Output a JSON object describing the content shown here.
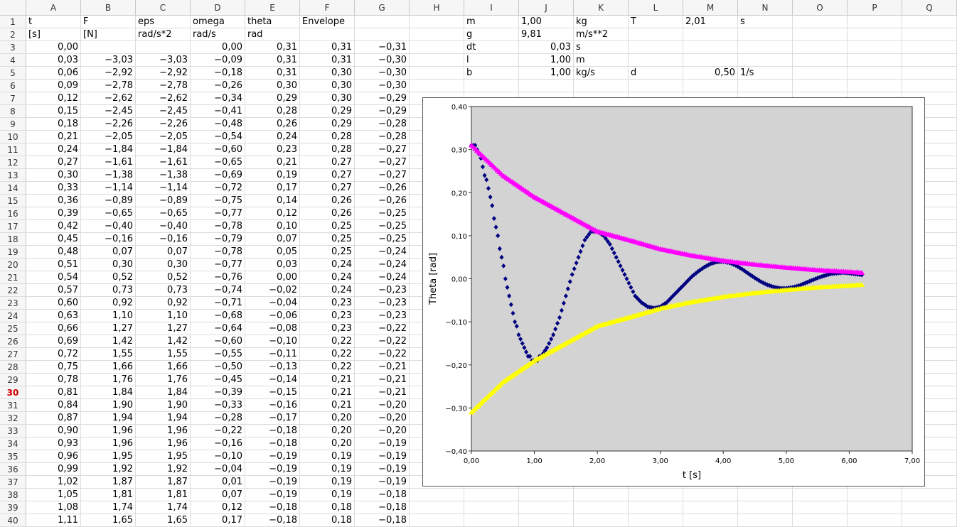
{
  "sheet": {
    "columns": [
      "A",
      "B",
      "C",
      "D",
      "E",
      "F",
      "G",
      "H",
      "I",
      "J",
      "K",
      "L",
      "M",
      "N",
      "O",
      "P",
      "Q"
    ],
    "active_row": "30",
    "rows": [
      {
        "n": "1",
        "cells": {
          "A": "t",
          "B": "F",
          "C": "eps",
          "D": "omega",
          "E": "theta",
          "F": "Envelope",
          "I": "m",
          "J": "1,00",
          "K": "kg",
          "L": "T",
          "M": "2,01",
          "N": "s"
        }
      },
      {
        "n": "2",
        "cells": {
          "A": "[s]",
          "B": "[N]",
          "C": "rad/s*2",
          "D": "rad/s",
          "E": "rad",
          "I": "g",
          "J": "9,81",
          "K": "m/s**2"
        }
      },
      {
        "n": "3",
        "cells": {
          "A": "0,00",
          "D": "0,00",
          "E": "0,31",
          "F": "0,31",
          "G": "−0,31",
          "I": "dt",
          "J": "0,03",
          "K": "s"
        }
      },
      {
        "n": "4",
        "cells": {
          "A": "0,03",
          "B": "−3,03",
          "C": "−3,03",
          "D": "−0,09",
          "E": "0,31",
          "F": "0,31",
          "G": "−0,30",
          "I": "l",
          "J": "1,00",
          "K": "m"
        }
      },
      {
        "n": "5",
        "cells": {
          "A": "0,06",
          "B": "−2,92",
          "C": "−2,92",
          "D": "−0,18",
          "E": "0,31",
          "F": "0,30",
          "G": "−0,30",
          "I": "b",
          "J": "1,00",
          "K": "kg/s",
          "L": "d",
          "M": "0,50",
          "N": "1/s"
        }
      },
      {
        "n": "6",
        "cells": {
          "A": "0,09",
          "B": "−2,78",
          "C": "−2,78",
          "D": "−0,26",
          "E": "0,30",
          "F": "0,30",
          "G": "−0,30"
        }
      },
      {
        "n": "7",
        "cells": {
          "A": "0,12",
          "B": "−2,62",
          "C": "−2,62",
          "D": "−0,34",
          "E": "0,29",
          "F": "0,30",
          "G": "−0,29"
        }
      },
      {
        "n": "8",
        "cells": {
          "A": "0,15",
          "B": "−2,45",
          "C": "−2,45",
          "D": "−0,41",
          "E": "0,28",
          "F": "0,29",
          "G": "−0,29"
        }
      },
      {
        "n": "9",
        "cells": {
          "A": "0,18",
          "B": "−2,26",
          "C": "−2,26",
          "D": "−0,48",
          "E": "0,26",
          "F": "0,29",
          "G": "−0,28"
        }
      },
      {
        "n": "10",
        "cells": {
          "A": "0,21",
          "B": "−2,05",
          "C": "−2,05",
          "D": "−0,54",
          "E": "0,24",
          "F": "0,28",
          "G": "−0,28"
        }
      },
      {
        "n": "11",
        "cells": {
          "A": "0,24",
          "B": "−1,84",
          "C": "−1,84",
          "D": "−0,60",
          "E": "0,23",
          "F": "0,28",
          "G": "−0,27"
        }
      },
      {
        "n": "12",
        "cells": {
          "A": "0,27",
          "B": "−1,61",
          "C": "−1,61",
          "D": "−0,65",
          "E": "0,21",
          "F": "0,27",
          "G": "−0,27"
        }
      },
      {
        "n": "13",
        "cells": {
          "A": "0,30",
          "B": "−1,38",
          "C": "−1,38",
          "D": "−0,69",
          "E": "0,19",
          "F": "0,27",
          "G": "−0,27"
        }
      },
      {
        "n": "14",
        "cells": {
          "A": "0,33",
          "B": "−1,14",
          "C": "−1,14",
          "D": "−0,72",
          "E": "0,17",
          "F": "0,27",
          "G": "−0,26"
        }
      },
      {
        "n": "15",
        "cells": {
          "A": "0,36",
          "B": "−0,89",
          "C": "−0,89",
          "D": "−0,75",
          "E": "0,14",
          "F": "0,26",
          "G": "−0,26"
        }
      },
      {
        "n": "16",
        "cells": {
          "A": "0,39",
          "B": "−0,65",
          "C": "−0,65",
          "D": "−0,77",
          "E": "0,12",
          "F": "0,26",
          "G": "−0,25"
        }
      },
      {
        "n": "17",
        "cells": {
          "A": "0,42",
          "B": "−0,40",
          "C": "−0,40",
          "D": "−0,78",
          "E": "0,10",
          "F": "0,25",
          "G": "−0,25"
        }
      },
      {
        "n": "18",
        "cells": {
          "A": "0,45",
          "B": "−0,16",
          "C": "−0,16",
          "D": "−0,79",
          "E": "0,07",
          "F": "0,25",
          "G": "−0,25"
        }
      },
      {
        "n": "19",
        "cells": {
          "A": "0,48",
          "B": "0,07",
          "C": "0,07",
          "D": "−0,78",
          "E": "0,05",
          "F": "0,25",
          "G": "−0,24"
        }
      },
      {
        "n": "20",
        "cells": {
          "A": "0,51",
          "B": "0,30",
          "C": "0,30",
          "D": "−0,77",
          "E": "0,03",
          "F": "0,24",
          "G": "−0,24"
        }
      },
      {
        "n": "21",
        "cells": {
          "A": "0,54",
          "B": "0,52",
          "C": "0,52",
          "D": "−0,76",
          "E": "0,00",
          "F": "0,24",
          "G": "−0,24"
        }
      },
      {
        "n": "22",
        "cells": {
          "A": "0,57",
          "B": "0,73",
          "C": "0,73",
          "D": "−0,74",
          "E": "−0,02",
          "F": "0,24",
          "G": "−0,23"
        }
      },
      {
        "n": "23",
        "cells": {
          "A": "0,60",
          "B": "0,92",
          "C": "0,92",
          "D": "−0,71",
          "E": "−0,04",
          "F": "0,23",
          "G": "−0,23"
        }
      },
      {
        "n": "24",
        "cells": {
          "A": "0,63",
          "B": "1,10",
          "C": "1,10",
          "D": "−0,68",
          "E": "−0,06",
          "F": "0,23",
          "G": "−0,23"
        }
      },
      {
        "n": "25",
        "cells": {
          "A": "0,66",
          "B": "1,27",
          "C": "1,27",
          "D": "−0,64",
          "E": "−0,08",
          "F": "0,23",
          "G": "−0,22"
        }
      },
      {
        "n": "26",
        "cells": {
          "A": "0,69",
          "B": "1,42",
          "C": "1,42",
          "D": "−0,60",
          "E": "−0,10",
          "F": "0,22",
          "G": "−0,22"
        }
      },
      {
        "n": "27",
        "cells": {
          "A": "0,72",
          "B": "1,55",
          "C": "1,55",
          "D": "−0,55",
          "E": "−0,11",
          "F": "0,22",
          "G": "−0,22"
        }
      },
      {
        "n": "28",
        "cells": {
          "A": "0,75",
          "B": "1,66",
          "C": "1,66",
          "D": "−0,50",
          "E": "−0,13",
          "F": "0,22",
          "G": "−0,21"
        }
      },
      {
        "n": "29",
        "cells": {
          "A": "0,78",
          "B": "1,76",
          "C": "1,76",
          "D": "−0,45",
          "E": "−0,14",
          "F": "0,21",
          "G": "−0,21"
        }
      },
      {
        "n": "30",
        "cells": {
          "A": "0,81",
          "B": "1,84",
          "C": "1,84",
          "D": "−0,39",
          "E": "−0,15",
          "F": "0,21",
          "G": "−0,21"
        }
      },
      {
        "n": "31",
        "cells": {
          "A": "0,84",
          "B": "1,90",
          "C": "1,90",
          "D": "−0,33",
          "E": "−0,16",
          "F": "0,21",
          "G": "−0,20"
        }
      },
      {
        "n": "32",
        "cells": {
          "A": "0,87",
          "B": "1,94",
          "C": "1,94",
          "D": "−0,28",
          "E": "−0,17",
          "F": "0,20",
          "G": "−0,20"
        }
      },
      {
        "n": "33",
        "cells": {
          "A": "0,90",
          "B": "1,96",
          "C": "1,96",
          "D": "−0,22",
          "E": "−0,18",
          "F": "0,20",
          "G": "−0,20"
        }
      },
      {
        "n": "34",
        "cells": {
          "A": "0,93",
          "B": "1,96",
          "C": "1,96",
          "D": "−0,16",
          "E": "−0,18",
          "F": "0,20",
          "G": "−0,19"
        }
      },
      {
        "n": "35",
        "cells": {
          "A": "0,96",
          "B": "1,95",
          "C": "1,95",
          "D": "−0,10",
          "E": "−0,19",
          "F": "0,19",
          "G": "−0,19"
        }
      },
      {
        "n": "36",
        "cells": {
          "A": "0,99",
          "B": "1,92",
          "C": "1,92",
          "D": "−0,04",
          "E": "−0,19",
          "F": "0,19",
          "G": "−0,19"
        }
      },
      {
        "n": "37",
        "cells": {
          "A": "1,02",
          "B": "1,87",
          "C": "1,87",
          "D": "0,01",
          "E": "−0,19",
          "F": "0,19",
          "G": "−0,19"
        }
      },
      {
        "n": "38",
        "cells": {
          "A": "1,05",
          "B": "1,81",
          "C": "1,81",
          "D": "0,07",
          "E": "−0,19",
          "F": "0,19",
          "G": "−0,18"
        }
      },
      {
        "n": "39",
        "cells": {
          "A": "1,08",
          "B": "1,74",
          "C": "1,74",
          "D": "0,12",
          "E": "−0,18",
          "F": "0,18",
          "G": "−0,18"
        }
      },
      {
        "n": "40",
        "cells": {
          "A": "1,11",
          "B": "1,65",
          "C": "1,65",
          "D": "0,17",
          "E": "−0,18",
          "F": "0,18",
          "G": "−0,18"
        }
      }
    ]
  },
  "chart_data": {
    "type": "scatter",
    "xlabel": "t [s]",
    "ylabel": "Theta [rad]",
    "xlim": [
      0,
      7
    ],
    "ylim": [
      -0.4,
      0.4
    ],
    "x_ticks": [
      "0,00",
      "1,00",
      "2,00",
      "3,00",
      "4,00",
      "5,00",
      "6,00",
      "7,00"
    ],
    "y_ticks": [
      "−0,40",
      "−0,30",
      "−0,20",
      "−0,10",
      "0,00",
      "0,10",
      "0,20",
      "0,30",
      "0,40"
    ],
    "background": "#d3d3d3",
    "grid": false,
    "series": [
      {
        "color": "#000080",
        "marker": "diamond",
        "x": [
          0,
          0.03,
          0.06,
          0.09,
          0.12,
          0.15,
          0.18,
          0.21,
          0.24,
          0.27,
          0.3,
          0.33,
          0.36,
          0.39,
          0.42,
          0.45,
          0.48,
          0.51,
          0.54,
          0.57,
          0.6,
          0.63,
          0.66,
          0.69,
          0.72,
          0.75,
          0.78,
          0.81,
          0.84,
          0.87,
          0.9,
          0.93,
          0.96,
          0.99,
          1.02,
          1.05,
          1.08,
          1.11,
          1.2,
          1.3,
          1.4,
          1.5,
          1.6,
          1.7,
          1.8,
          1.9,
          2.0,
          2.1,
          2.2,
          2.3,
          2.4,
          2.5,
          2.6,
          2.7,
          2.8,
          2.9,
          3.0,
          3.1,
          3.2,
          3.3,
          3.4,
          3.5,
          3.6,
          3.7,
          3.8,
          3.9,
          4.0,
          4.1,
          4.2,
          4.3,
          4.4,
          4.5,
          4.6,
          4.7,
          4.8,
          4.9,
          5.0,
          5.1,
          5.2,
          5.3,
          5.4,
          5.5,
          5.6,
          5.7,
          5.8,
          5.9,
          6.0,
          6.1,
          6.2
        ],
        "y": [
          0.31,
          0.31,
          0.31,
          0.3,
          0.29,
          0.28,
          0.26,
          0.24,
          0.23,
          0.21,
          0.19,
          0.17,
          0.14,
          0.12,
          0.1,
          0.07,
          0.05,
          0.03,
          0.0,
          -0.02,
          -0.04,
          -0.06,
          -0.08,
          -0.1,
          -0.11,
          -0.13,
          -0.14,
          -0.15,
          -0.16,
          -0.17,
          -0.18,
          -0.18,
          -0.19,
          -0.19,
          -0.19,
          -0.19,
          -0.18,
          -0.18,
          -0.16,
          -0.13,
          -0.09,
          -0.04,
          0.01,
          0.05,
          0.09,
          0.11,
          0.11,
          0.1,
          0.08,
          0.05,
          0.02,
          -0.01,
          -0.04,
          -0.055,
          -0.065,
          -0.068,
          -0.065,
          -0.055,
          -0.04,
          -0.025,
          -0.01,
          0.005,
          0.017,
          0.027,
          0.035,
          0.039,
          0.04,
          0.037,
          0.031,
          0.022,
          0.012,
          0.002,
          -0.007,
          -0.014,
          -0.019,
          -0.022,
          -0.022,
          -0.02,
          -0.016,
          -0.01,
          -0.004,
          0.002,
          0.007,
          0.011,
          0.013,
          0.014,
          0.013,
          0.011,
          0.009
        ]
      },
      {
        "color": "#ff00ff",
        "marker": "triangle",
        "x": [
          0,
          0.5,
          1.0,
          1.5,
          2.0,
          2.5,
          3.0,
          3.5,
          4.0,
          4.5,
          5.0,
          5.5,
          6.0,
          6.2
        ],
        "y": [
          0.31,
          0.24,
          0.19,
          0.15,
          0.11,
          0.09,
          0.069,
          0.054,
          0.042,
          0.033,
          0.026,
          0.02,
          0.016,
          0.014
        ]
      },
      {
        "color": "#ffff00",
        "marker": "triangle",
        "x": [
          0,
          0.5,
          1.0,
          1.5,
          2.0,
          2.5,
          3.0,
          3.5,
          4.0,
          4.5,
          5.0,
          5.5,
          6.0,
          6.2
        ],
        "y": [
          -0.31,
          -0.24,
          -0.19,
          -0.15,
          -0.11,
          -0.09,
          -0.069,
          -0.054,
          -0.042,
          -0.033,
          -0.026,
          -0.02,
          -0.016,
          -0.014
        ]
      }
    ]
  }
}
